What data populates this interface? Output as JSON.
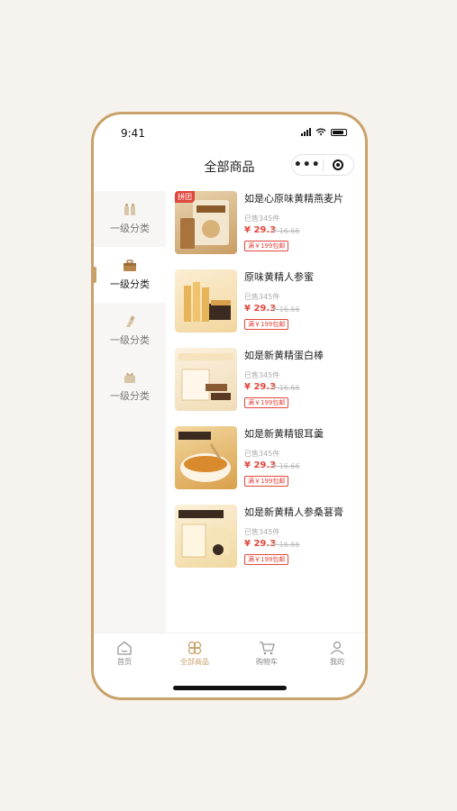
{
  "status_bar": {
    "time": "9:41"
  },
  "navbar": {
    "title": "全部商品"
  },
  "sidebar": {
    "items": [
      {
        "label": "一级分类",
        "icon": "bottles-icon",
        "active": false
      },
      {
        "label": "一级分类",
        "icon": "box-icon",
        "active": true
      },
      {
        "label": "一级分类",
        "icon": "bottle-icon",
        "active": false
      },
      {
        "label": "一级分类",
        "icon": "gift-icon",
        "active": false
      }
    ]
  },
  "products": [
    {
      "name": "如是心原味黄精燕麦片",
      "badge": "拼团",
      "sold": "已售345件",
      "price": "¥ 29.3",
      "original": "¥ 16.66",
      "coupon": "满￥199包邮"
    },
    {
      "name": "原味黄精人参蜜",
      "badge": "",
      "sold": "已售345件",
      "price": "¥ 29.3",
      "original": "¥ 16.66",
      "coupon": "满￥199包邮"
    },
    {
      "name": "如是新黄精蛋白棒",
      "badge": "",
      "sold": "已售345件",
      "price": "¥ 29.3",
      "original": "¥ 16.66",
      "coupon": "满￥199包邮"
    },
    {
      "name": "如是新黄精银耳羹",
      "badge": "",
      "sold": "已售345件",
      "price": "¥ 29.3",
      "original": "¥ 16.66",
      "coupon": "满￥199包邮"
    },
    {
      "name": "如是新黄精人参桑葚膏",
      "badge": "",
      "sold": "已售345件",
      "price": "¥ 29.3",
      "original": "¥ 16.66",
      "coupon": "满￥199包邮"
    }
  ],
  "tabbar": {
    "items": [
      {
        "label": "首页",
        "icon": "home-icon",
        "active": false
      },
      {
        "label": "全部商品",
        "icon": "clover-icon",
        "active": true
      },
      {
        "label": "购物车",
        "icon": "cart-icon",
        "active": false
      },
      {
        "label": "我的",
        "icon": "user-icon",
        "active": false
      }
    ]
  },
  "colors": {
    "accent": "#c9a16a",
    "price": "#e0473c",
    "background": "#f6f3ee"
  }
}
